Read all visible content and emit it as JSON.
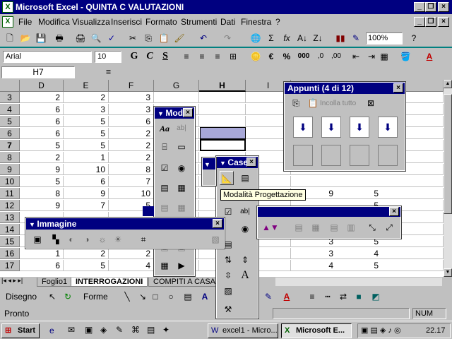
{
  "window": {
    "title": "Microsoft Excel - QUINTA C VALUTAZIONI",
    "icon": "excel-icon"
  },
  "menu": [
    "File",
    "Modifica",
    "Visualizza",
    "Inserisci",
    "Formato",
    "Strumenti",
    "Dati",
    "Finestra",
    "?"
  ],
  "toolbar_standard": {
    "zoom": "100%"
  },
  "toolbar_format": {
    "font": "Arial",
    "size": "10",
    "bold": "G",
    "italic": "C",
    "underline": "S",
    "percent": "%",
    "thousands": "000",
    "euro": "€"
  },
  "formula_bar": {
    "cell_ref": "H7",
    "equals": "="
  },
  "columns": [
    "D",
    "E",
    "F",
    "G",
    "H",
    "I"
  ],
  "rows": [
    {
      "n": "3",
      "d": "2",
      "e": "2",
      "f": "3"
    },
    {
      "n": "4",
      "d": "6",
      "e": "3",
      "f": "3"
    },
    {
      "n": "5",
      "d": "6",
      "e": "5",
      "f": "6"
    },
    {
      "n": "6",
      "d": "6",
      "e": "5",
      "f": "2"
    },
    {
      "n": "7",
      "d": "5",
      "e": "5",
      "f": "2"
    },
    {
      "n": "8",
      "d": "2",
      "e": "1",
      "f": "2"
    },
    {
      "n": "9",
      "d": "9",
      "e": "10",
      "f": "8"
    },
    {
      "n": "10",
      "d": "5",
      "e": "6",
      "f": "7"
    },
    {
      "n": "11",
      "d": "8",
      "e": "9",
      "f": "10"
    },
    {
      "n": "12",
      "d": "9",
      "e": "7",
      "f": "5"
    },
    {
      "n": "13",
      "d": "",
      "e": "",
      "f": ""
    },
    {
      "n": "14",
      "d": "",
      "e": "",
      "f": ""
    },
    {
      "n": "15",
      "d": "",
      "e": "",
      "f": ""
    },
    {
      "n": "16",
      "d": "1",
      "e": "2",
      "f": "2"
    },
    {
      "n": "17",
      "d": "6",
      "e": "5",
      "f": "4"
    }
  ],
  "right_values": [
    {
      "row": "11",
      "i": "9",
      "j": "5"
    },
    {
      "row": "12",
      "i": "",
      "j": "5"
    },
    {
      "row": "15",
      "i": "3",
      "j": "5"
    },
    {
      "row": "16",
      "i": "3",
      "j": "4"
    },
    {
      "row": "17",
      "i": "4",
      "j": "5"
    }
  ],
  "sheet_tabs": [
    "Foglio1",
    "INTERROGAZIONI",
    "COMPITI A CASA"
  ],
  "palettes": {
    "moduli": {
      "title": "Mod",
      "text_glyph": "Aa",
      "label_glyph": "ab|"
    },
    "casella": {
      "title": "Case"
    },
    "immagine": {
      "title": "Immagine"
    },
    "appunti": {
      "title": "Appunti (4 di 12)",
      "paste_all": "Incolla tutto"
    }
  },
  "tooltip": "Modalità Progettazione",
  "drawing_toolbar": {
    "disegno": "Disegno",
    "forme": "Forme"
  },
  "status": {
    "text": "Pronto",
    "num": "NUM"
  },
  "taskbar": {
    "start": "Start",
    "task1": "excel1 - Micro...",
    "task2": "Microsoft E...",
    "clock": "22.17"
  }
}
